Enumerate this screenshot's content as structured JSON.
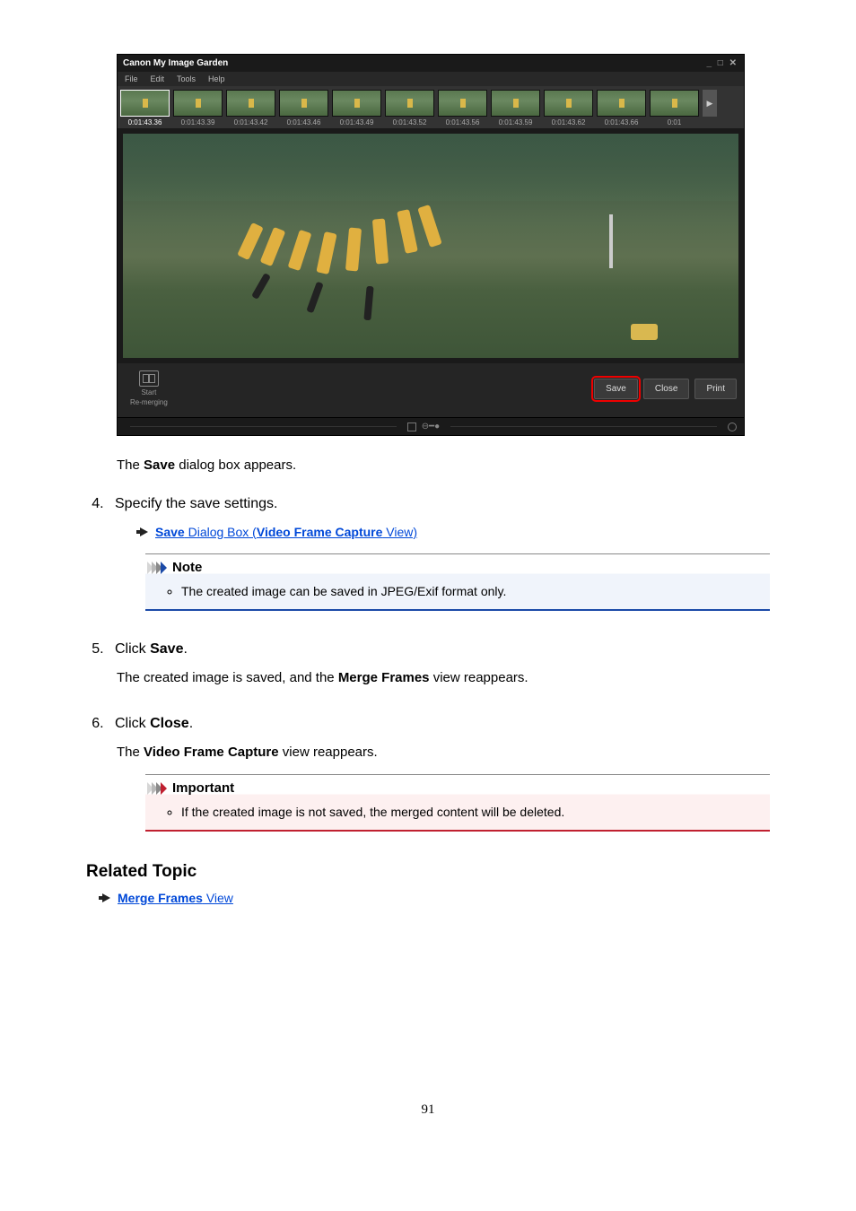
{
  "screenshot": {
    "title": "Canon My Image Garden",
    "win_controls": "_ □ ✕",
    "menu": [
      "File",
      "Edit",
      "Tools",
      "Help"
    ],
    "timestamps": [
      "0:01:43.36",
      "0:01:43.39",
      "0:01:43.42",
      "0:01:43.46",
      "0:01:43.49",
      "0:01:43.52",
      "0:01:43.56",
      "0:01:43.59",
      "0:01:43.62",
      "0:01:43.66",
      "0:01"
    ],
    "remerge_line1": "Start",
    "remerge_line2": "Re-merging",
    "btn_save": "Save",
    "btn_close": "Close",
    "btn_print": "Print"
  },
  "text_after_screenshot_pre": "The ",
  "text_after_screenshot_bold": "Save",
  "text_after_screenshot_post": " dialog box appears.",
  "step4": "Specify the save settings.",
  "step4_link_b1": "Save",
  "step4_link_mid": " Dialog Box (",
  "step4_link_b2": "Video Frame Capture",
  "step4_link_end": " View)",
  "note_label": "Note",
  "note_item": "The created image can be saved in JPEG/Exif format only.",
  "step5_pre": "Click ",
  "step5_bold": "Save",
  "step5_post": ".",
  "step5_body_pre": "The created image is saved, and the ",
  "step5_body_bold": "Merge Frames",
  "step5_body_post": " view reappears.",
  "step6_pre": "Click ",
  "step6_bold": "Close",
  "step6_post": ".",
  "step6_body_pre": "The ",
  "step6_body_bold": "Video Frame Capture",
  "step6_body_post": " view reappears.",
  "important_label": "Important",
  "important_item": "If the created image is not saved, the merged content will be deleted.",
  "related_heading": "Related Topic",
  "related_link_b": "Merge Frames",
  "related_link_rest": " View",
  "page_number": "91"
}
